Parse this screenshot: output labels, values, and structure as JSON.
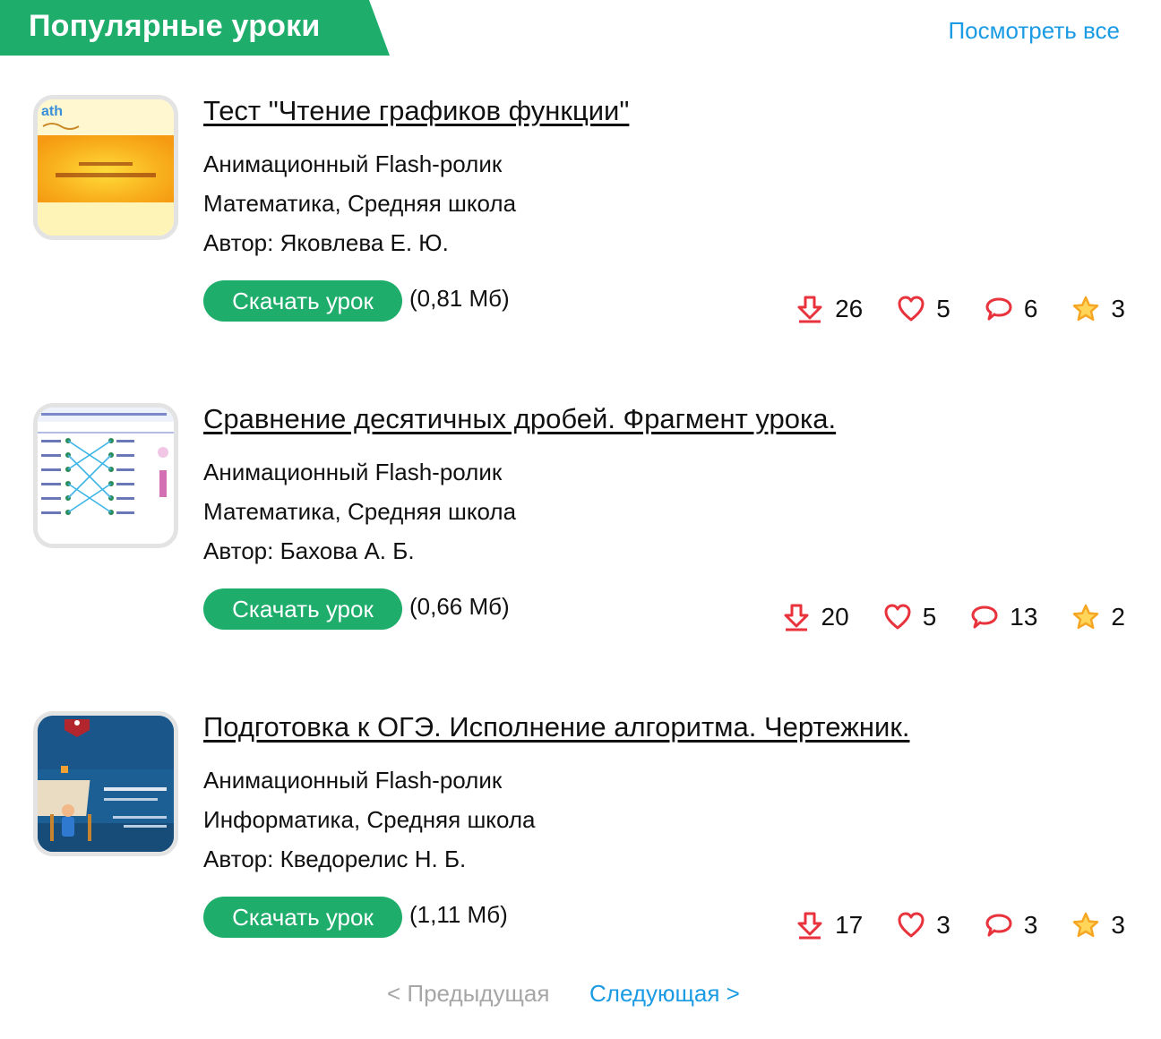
{
  "header": {
    "title": "Популярные уроки",
    "view_all": "Посмотреть все"
  },
  "lessons": [
    {
      "title": "Тест \"Чтение графиков функции\"",
      "type": "Анимационный Flash-ролик",
      "subject": "Математика, Средняя школа",
      "author": "Автор: Яковлева Е. Ю.",
      "download_label": "Скачать урок",
      "size": "(0,81 Мб)",
      "stats": {
        "downloads": "26",
        "likes": "5",
        "comments": "6",
        "rating": "3"
      }
    },
    {
      "title": "Сравнение десятичных дробей. Фрагмент урока.",
      "type": "Анимационный Flash-ролик",
      "subject": "Математика, Средняя школа",
      "author": "Автор: Бахова А. Б.",
      "download_label": "Скачать урок",
      "size": "(0,66 Мб)",
      "stats": {
        "downloads": "20",
        "likes": "5",
        "comments": "13",
        "rating": "2"
      }
    },
    {
      "title": "Подготовка к ОГЭ. Исполнение алгоритма. Чертежник.",
      "type": "Анимационный Flash-ролик",
      "subject": "Информатика, Средняя школа",
      "author": "Автор: Кведорелис Н. Б.",
      "download_label": "Скачать урок",
      "size": "(1,11 Мб)",
      "stats": {
        "downloads": "17",
        "likes": "3",
        "comments": "3",
        "rating": "3"
      }
    }
  ],
  "pagination": {
    "prev": "< Предыдущая",
    "next": "Следующая >"
  },
  "colors": {
    "accent_green": "#1fad6c",
    "link_blue": "#1a9be3",
    "icon_red": "#e8323c",
    "star_orange": "#f5a623"
  },
  "icons": [
    "download-icon",
    "heart-icon",
    "comment-icon",
    "star-icon"
  ]
}
